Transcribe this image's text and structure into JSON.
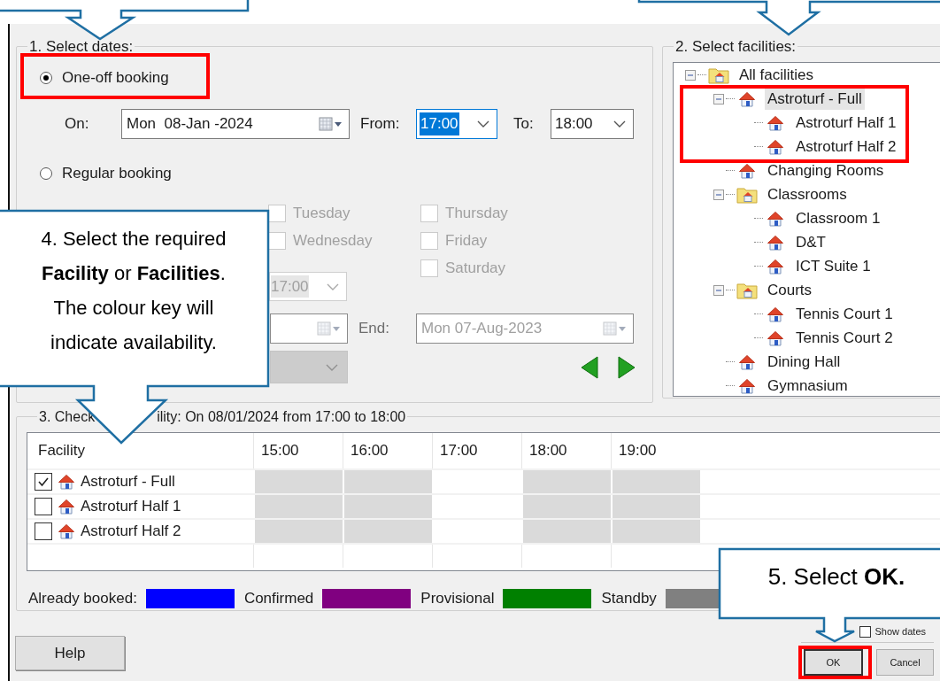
{
  "dates": {
    "legend": "1. Select dates:",
    "booking_types": [
      {
        "label": "One-off booking",
        "selected": true,
        "highlighted": true
      },
      {
        "label": "Regular booking",
        "selected": false,
        "highlighted": false
      }
    ],
    "on": {
      "label": "On:",
      "value": "Mon  08-Jan -2024"
    },
    "from": {
      "label": "From:",
      "value": "17:00",
      "focused": true
    },
    "to": {
      "label": "To:",
      "value": "18:00",
      "focused": false
    },
    "regular": {
      "disabled": true,
      "weekdays": [
        {
          "label": "Tuesday",
          "checked": false
        },
        {
          "label": "Wednesday",
          "checked": false
        },
        {
          "label": "Thursday",
          "checked": false
        },
        {
          "label": "Friday",
          "checked": false
        },
        {
          "label": "Saturday",
          "checked": false
        }
      ],
      "time_value": "17:00",
      "end": {
        "label": "End:",
        "value": "Mon 07-Aug-2023"
      }
    }
  },
  "facilities": {
    "legend": "2. Select facilities:",
    "tree": [
      {
        "label": "All facilities",
        "kind": "folder",
        "expanded": true,
        "selected": false,
        "highlighted": false,
        "children": [
          {
            "label": "Astroturf - Full",
            "kind": "house",
            "expanded": true,
            "selected": true,
            "highlighted": true,
            "children": [
              {
                "label": "Astroturf Half 1",
                "kind": "house",
                "selected": false,
                "highlighted": false
              },
              {
                "label": "Astroturf Half 2",
                "kind": "house",
                "selected": false,
                "highlighted": false
              }
            ]
          },
          {
            "label": "Changing Rooms",
            "kind": "house",
            "selected": false,
            "highlighted": false
          },
          {
            "label": "Classrooms",
            "kind": "folder",
            "expanded": true,
            "selected": false,
            "highlighted": false,
            "children": [
              {
                "label": "Classroom 1",
                "kind": "house",
                "selected": false,
                "highlighted": false
              },
              {
                "label": "D&T",
                "kind": "house",
                "selected": false,
                "highlighted": false
              },
              {
                "label": "ICT Suite 1",
                "kind": "house",
                "selected": false,
                "highlighted": false
              }
            ]
          },
          {
            "label": "Courts",
            "kind": "folder",
            "expanded": true,
            "selected": false,
            "highlighted": false,
            "children": [
              {
                "label": "Tennis Court 1",
                "kind": "house",
                "selected": false,
                "highlighted": false
              },
              {
                "label": "Tennis Court 2",
                "kind": "house",
                "selected": false,
                "highlighted": false
              }
            ]
          },
          {
            "label": "Dining Hall",
            "kind": "house",
            "selected": false,
            "highlighted": false
          },
          {
            "label": "Gymnasium",
            "kind": "house",
            "selected": false,
            "highlighted": false
          }
        ]
      }
    ]
  },
  "availability": {
    "legend_parts": [
      "3. Check",
      "ility: On 08/01/2024 from 17:00 to 18:00"
    ],
    "columns": [
      "Facility",
      "15:00",
      "16:00",
      "17:00",
      "18:00",
      "19:00"
    ],
    "rows": [
      {
        "label": "Astroturf - Full",
        "checked": true,
        "cells": [
          {
            "shaded": true
          },
          {
            "shaded": true
          },
          {
            "shaded": false
          },
          {
            "shaded": true
          },
          {
            "shaded": true
          }
        ]
      },
      {
        "label": "Astroturf Half 1",
        "checked": false,
        "cells": [
          {
            "shaded": true
          },
          {
            "shaded": true
          },
          {
            "shaded": false
          },
          {
            "shaded": true
          },
          {
            "shaded": true
          }
        ]
      },
      {
        "label": "Astroturf Half 2",
        "checked": false,
        "cells": [
          {
            "shaded": true
          },
          {
            "shaded": true
          },
          {
            "shaded": false
          },
          {
            "shaded": true
          },
          {
            "shaded": true
          }
        ]
      }
    ],
    "key": [
      {
        "label": "Already booked:",
        "color": "#0000ff"
      },
      {
        "label": "Confirmed",
        "color": "#800080"
      },
      {
        "label": "Provisional",
        "color": "#008000"
      },
      {
        "label": "Standby",
        "color": "#808080"
      }
    ]
  },
  "buttons": {
    "help": "Help",
    "show_dates": {
      "label": "Show dates",
      "checked": false
    },
    "ok": {
      "label": "OK",
      "highlighted": true
    },
    "cancel": "Cancel"
  },
  "callouts": [
    {
      "text": "4. Select the required **Facility** or **Facilities**. The colour key will indicate availability."
    },
    {
      "text": "5. Select **OK.**"
    }
  ]
}
